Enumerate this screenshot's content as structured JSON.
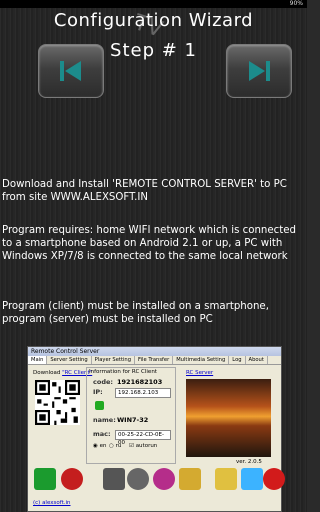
{
  "status": {
    "battery": "90%"
  },
  "header": {
    "title": "Configuration Wizard",
    "step": "Step # 1",
    "watermark": "TV"
  },
  "nav": {
    "prev_icon": "skip-back-icon",
    "next_icon": "skip-forward-icon"
  },
  "paragraphs": {
    "download": "Download and Install 'REMOTE CONTROL SERVER' to PC from site WWW.ALEXSOFT.IN",
    "requirements": "Program requires: home WIFI network which is connected to a smartphone based on Android 2.1 or up, a PC with Windows XP/7/8 is connected to the same local network",
    "client_line": " Program (client) must be installed on a smartphone,",
    "server_line": "program (server) must be installed on PC"
  },
  "screenshot": {
    "window_title": "Remote Control Server",
    "tabs": [
      "Main",
      "Server Setting",
      "Player Setting",
      "File Transfer",
      "Multimedia Setting",
      "Log",
      "About"
    ],
    "download_prefix": "Download ",
    "download_link": "\"RC Client\"",
    "info_header": "Information for RC Client",
    "code_label": "code:",
    "code_value": "1921682103",
    "ip_label": "IP:",
    "ip_value": "192.168.2.103",
    "name_label": "name:",
    "name_value": "WIN7-32",
    "mac_label": "mac:",
    "mac_value": "00-25-22-CD-0E-00",
    "lang_en": "en",
    "lang_ru": "ru",
    "autorun": "autorun",
    "rc_server_link": "RC Server",
    "version": "ver. 2.0.5",
    "footer_link": "(c) alexsoft.in"
  }
}
